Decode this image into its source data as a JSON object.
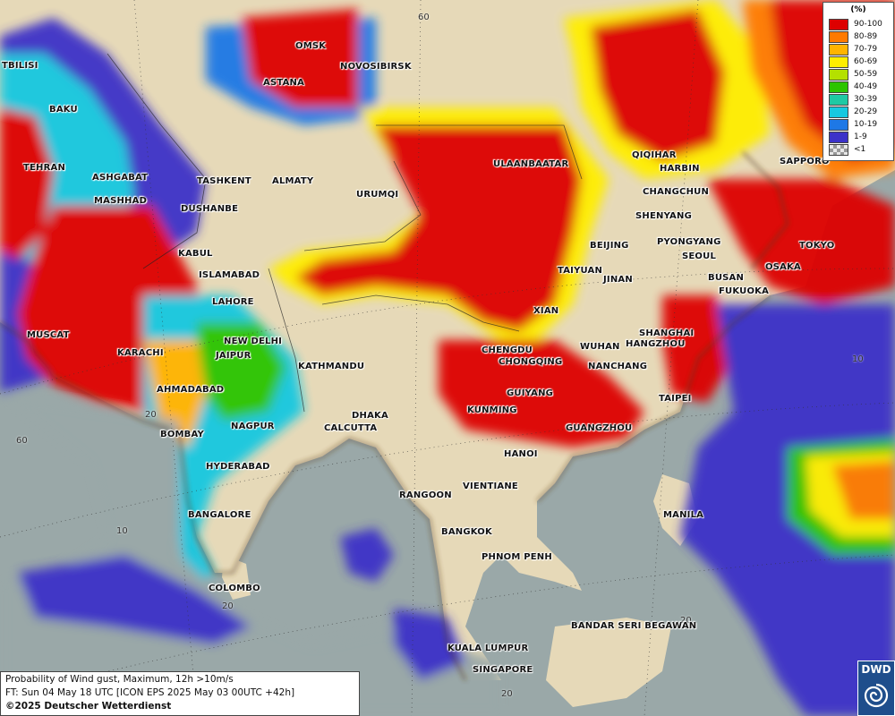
{
  "legend": {
    "title": "(%)",
    "items": [
      {
        "label": "90-100",
        "color": "#dd0000"
      },
      {
        "label": "80-89",
        "color": "#ff7a00"
      },
      {
        "label": "70-79",
        "color": "#ffb400"
      },
      {
        "label": "60-69",
        "color": "#ffee00"
      },
      {
        "label": "50-59",
        "color": "#b4e000"
      },
      {
        "label": "40-49",
        "color": "#2cc400"
      },
      {
        "label": "30-39",
        "color": "#1ec9a4"
      },
      {
        "label": "20-29",
        "color": "#17c8e0"
      },
      {
        "label": "10-19",
        "color": "#1e78e6"
      },
      {
        "label": "1-9",
        "color": "#3c32c8"
      },
      {
        "label": "<1",
        "color": "checker"
      }
    ]
  },
  "info": {
    "line1": "Probability of Wind gust, Maximum, 12h >10m/s",
    "line2": "FT: Sun 04 May 18 UTC [ICON EPS 2025 May 03 00UTC +42h]",
    "line3": "©2025 Deutscher Wetterdienst"
  },
  "logo": {
    "text": "DWD"
  },
  "grid_labels": [
    "60",
    "60",
    "20",
    "10",
    "10",
    "20",
    "20",
    "20"
  ],
  "cities": [
    {
      "name": "TBILISI"
    },
    {
      "name": "BAKU"
    },
    {
      "name": "OMSK"
    },
    {
      "name": "NOVOSIBIRSK"
    },
    {
      "name": "ASTANA"
    },
    {
      "name": "TEHRAN"
    },
    {
      "name": "ASHGABAT"
    },
    {
      "name": "MASHHAD"
    },
    {
      "name": "TASHKENT"
    },
    {
      "name": "ALMATY"
    },
    {
      "name": "DUSHANBE"
    },
    {
      "name": "URUMQI"
    },
    {
      "name": "ULAANBAATAR"
    },
    {
      "name": "QIQIHAR"
    },
    {
      "name": "HARBIN"
    },
    {
      "name": "CHANGCHUN"
    },
    {
      "name": "SHENYANG"
    },
    {
      "name": "SAPPORO"
    },
    {
      "name": "KABUL"
    },
    {
      "name": "ISLAMABAD"
    },
    {
      "name": "LAHORE"
    },
    {
      "name": "BEIJING"
    },
    {
      "name": "PYONGYANG"
    },
    {
      "name": "SEOUL"
    },
    {
      "name": "TOKYO"
    },
    {
      "name": "TAIYUAN"
    },
    {
      "name": "JINAN"
    },
    {
      "name": "BUSAN"
    },
    {
      "name": "OSAKA"
    },
    {
      "name": "FUKUOKA"
    },
    {
      "name": "XIAN"
    },
    {
      "name": "MUSCAT"
    },
    {
      "name": "NEW DELHI"
    },
    {
      "name": "SHANGHAI"
    },
    {
      "name": "KARACHI"
    },
    {
      "name": "JAIPUR"
    },
    {
      "name": "CHENGDU"
    },
    {
      "name": "WUHAN"
    },
    {
      "name": "HANGZHOU"
    },
    {
      "name": "KATHMANDU"
    },
    {
      "name": "CHONGQING"
    },
    {
      "name": "NANCHANG"
    },
    {
      "name": "AHMADABAD"
    },
    {
      "name": "GUIYANG"
    },
    {
      "name": "TAIPEI"
    },
    {
      "name": "KUNMING"
    },
    {
      "name": "DHAKA"
    },
    {
      "name": "NAGPUR"
    },
    {
      "name": "CALCUTTA"
    },
    {
      "name": "BOMBAY"
    },
    {
      "name": "GUANGZHOU"
    },
    {
      "name": "HANOI"
    },
    {
      "name": "HYDERABAD"
    },
    {
      "name": "VIENTIANE"
    },
    {
      "name": "RANGOON"
    },
    {
      "name": "BANGALORE"
    },
    {
      "name": "MANILA"
    },
    {
      "name": "BANGKOK"
    },
    {
      "name": "PHNOM PENH"
    },
    {
      "name": "COLOMBO"
    },
    {
      "name": "BANDAR SERI BEGAWAN"
    },
    {
      "name": "KUALA LUMPUR"
    },
    {
      "name": "SINGAPORE"
    }
  ]
}
